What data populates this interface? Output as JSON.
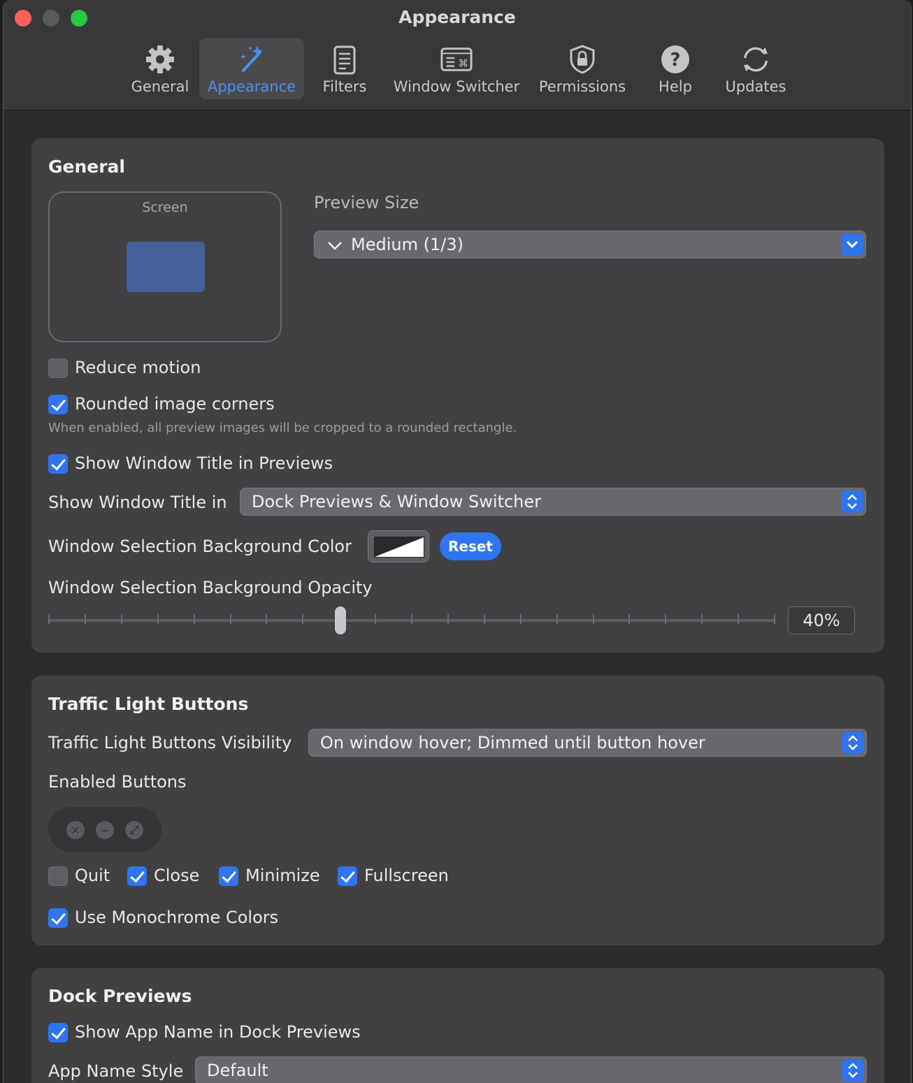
{
  "window": {
    "title": "Appearance"
  },
  "tabs": [
    {
      "label": "General",
      "icon": "gear-icon"
    },
    {
      "label": "Appearance",
      "icon": "magic-wand-icon"
    },
    {
      "label": "Filters",
      "icon": "list-document-icon"
    },
    {
      "label": "Window Switcher",
      "icon": "keyboard-switcher-icon"
    },
    {
      "label": "Permissions",
      "icon": "lock-shield-icon"
    },
    {
      "label": "Help",
      "icon": "question-icon"
    },
    {
      "label": "Updates",
      "icon": "refresh-icon"
    }
  ],
  "general": {
    "title": "General",
    "screen_caption": "Screen",
    "preview_size_label": "Preview Size",
    "preview_size_value": "Medium (1/3)",
    "reduce_motion": {
      "label": "Reduce motion",
      "checked": false
    },
    "rounded_corners": {
      "label": "Rounded image corners",
      "checked": true
    },
    "rounded_hint": "When enabled, all preview images will be cropped to a rounded rectangle.",
    "show_title": {
      "label": "Show Window Title in Previews",
      "checked": true
    },
    "show_title_in_label": "Show Window Title in",
    "show_title_in_value": "Dock Previews & Window Switcher",
    "bg_color_label": "Window Selection Background Color",
    "reset_label": "Reset",
    "opacity_label": "Window Selection Background Opacity",
    "opacity_value": "40%"
  },
  "traffic": {
    "title": "Traffic Light Buttons",
    "visibility_label": "Traffic Light Buttons Visibility",
    "visibility_value": "On window hover; Dimmed until button hover",
    "enabled_label": "Enabled Buttons",
    "buttons": [
      {
        "label": "Quit",
        "checked": false
      },
      {
        "label": "Close",
        "checked": true
      },
      {
        "label": "Minimize",
        "checked": true
      },
      {
        "label": "Fullscreen",
        "checked": true
      }
    ],
    "monochrome": {
      "label": "Use Monochrome Colors",
      "checked": true
    }
  },
  "dock": {
    "title": "Dock Previews",
    "show_app_name": {
      "label": "Show App Name in Dock Previews",
      "checked": true
    },
    "app_name_style_label": "App Name Style",
    "app_name_style_value": "Default"
  },
  "colors": {
    "accent": "#2f74f0",
    "window_bg": "#2b2b2d",
    "section_bg": "#414144"
  }
}
